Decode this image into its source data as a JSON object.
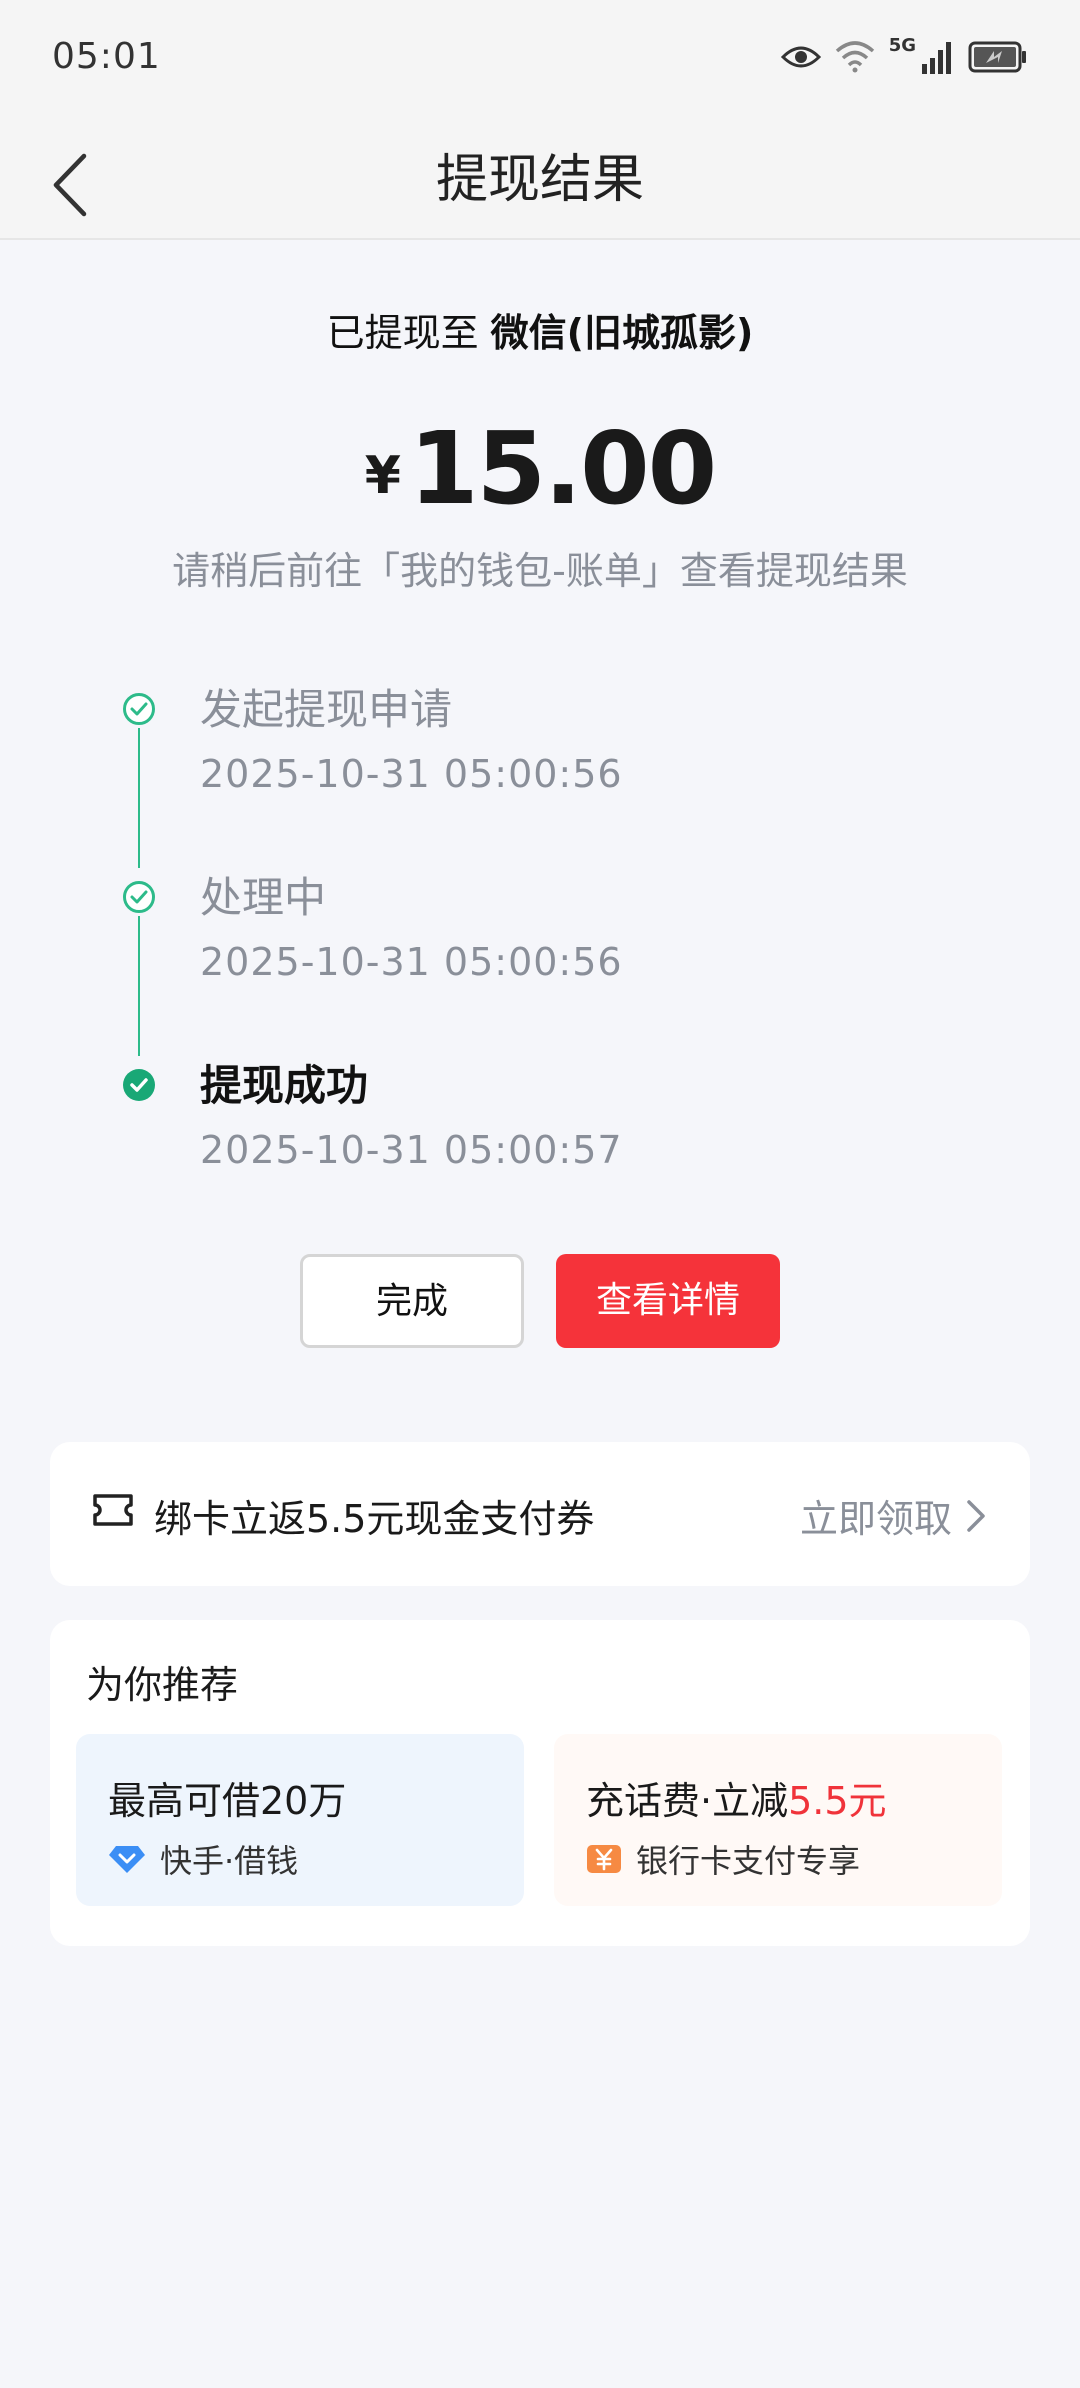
{
  "status_bar": {
    "time": "05:01",
    "network": "5G",
    "icons": [
      "eye-icon",
      "wifi-icon",
      "cellular-signal-icon",
      "battery-charging-icon"
    ]
  },
  "header": {
    "title": "提现结果",
    "back_icon": "chevron-left-icon"
  },
  "result": {
    "destination_prefix": "已提现至",
    "destination_name": "微信(旧城孤影)",
    "currency_symbol": "¥",
    "amount": "15.00",
    "hint": "请稍后前往「我的钱包-账单」查看提现结果"
  },
  "steps": [
    {
      "title": "发起提现申请",
      "time": "2025-10-31 05:00:56",
      "state": "passed"
    },
    {
      "title": "处理中",
      "time": "2025-10-31 05:00:56",
      "state": "passed"
    },
    {
      "title": "提现成功",
      "time": "2025-10-31 05:00:57",
      "state": "current"
    }
  ],
  "buttons": {
    "done_label": "完成",
    "detail_label": "查看详情"
  },
  "promo": {
    "icon": "ticket-icon",
    "text": "绑卡立返5.5元现金支付券",
    "link_label": "立即领取"
  },
  "recommend": {
    "title": "为你推荐",
    "items": [
      {
        "title": "最高可借20万",
        "sub_icon": "diamond-icon",
        "subtitle": "快手·借钱"
      },
      {
        "title_prefix": "充话费·立减",
        "title_highlight": "5.5元",
        "sub_icon": "yuan-coupon-icon",
        "subtitle": "银行卡支付专享"
      }
    ]
  },
  "colors": {
    "accent_red": "#f5333a",
    "success_green": "#19a876",
    "timeline_green": "#2dbb8a",
    "muted_text": "#8a8f99",
    "background": "#f5f6fa"
  }
}
